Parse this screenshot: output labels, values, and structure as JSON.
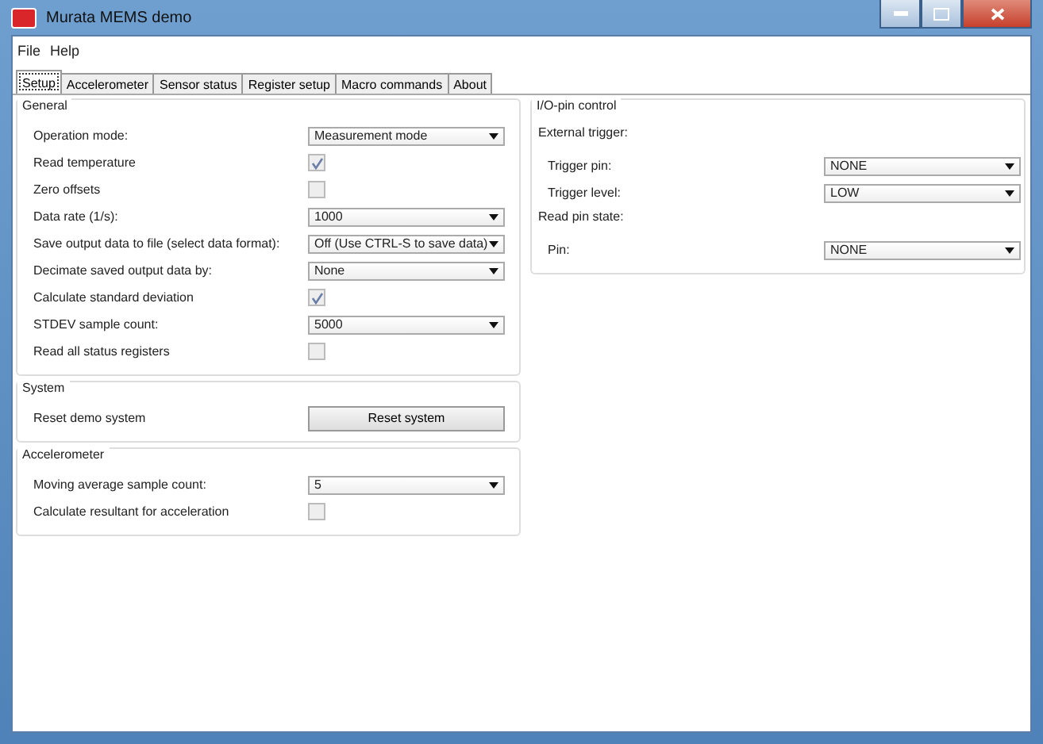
{
  "window": {
    "title": "Murata MEMS demo"
  },
  "menu": [
    "File",
    "Help"
  ],
  "tabs": [
    {
      "label": "Setup",
      "selected": true
    },
    {
      "label": "Accelerometer",
      "selected": false
    },
    {
      "label": "Sensor status",
      "selected": false
    },
    {
      "label": "Register setup",
      "selected": false
    },
    {
      "label": "Macro commands",
      "selected": false
    },
    {
      "label": "About",
      "selected": false
    }
  ],
  "general": {
    "title": "General",
    "rows": [
      {
        "kind": "select",
        "label": "Operation mode:",
        "value": "Measurement mode"
      },
      {
        "kind": "checkbox",
        "label": "Read temperature",
        "checked": true
      },
      {
        "kind": "checkbox",
        "label": "Zero offsets",
        "checked": false
      },
      {
        "kind": "select",
        "label": "Data rate (1/s):",
        "value": "1000"
      },
      {
        "kind": "select",
        "label": "Save output data to file (select data format):",
        "value": "Off (Use CTRL-S to save data)"
      },
      {
        "kind": "select",
        "label": "Decimate saved output data by:",
        "value": "None"
      },
      {
        "kind": "checkbox",
        "label": "Calculate standard deviation",
        "checked": true
      },
      {
        "kind": "select",
        "label": "STDEV sample count:",
        "value": "5000"
      },
      {
        "kind": "checkbox",
        "label": "Read all status registers",
        "checked": false
      }
    ]
  },
  "system": {
    "title": "System",
    "rows": [
      {
        "kind": "button",
        "label": "Reset demo system",
        "value": "Reset system"
      }
    ]
  },
  "accelerometer": {
    "title": "Accelerometer",
    "rows": [
      {
        "kind": "select",
        "label": "Moving average sample count:",
        "value": "5"
      },
      {
        "kind": "checkbox",
        "label": "Calculate resultant for acceleration",
        "checked": false
      }
    ]
  },
  "io": {
    "title": "I/O-pin control",
    "sections": [
      {
        "heading": "External trigger:",
        "rows": [
          {
            "kind": "select",
            "label": "Trigger pin:",
            "value": "NONE"
          },
          {
            "kind": "select",
            "label": "Trigger level:",
            "value": "LOW"
          }
        ]
      },
      {
        "heading": "Read pin state:",
        "rows": [
          {
            "kind": "select",
            "label": "Pin:",
            "value": "NONE"
          }
        ]
      }
    ]
  }
}
